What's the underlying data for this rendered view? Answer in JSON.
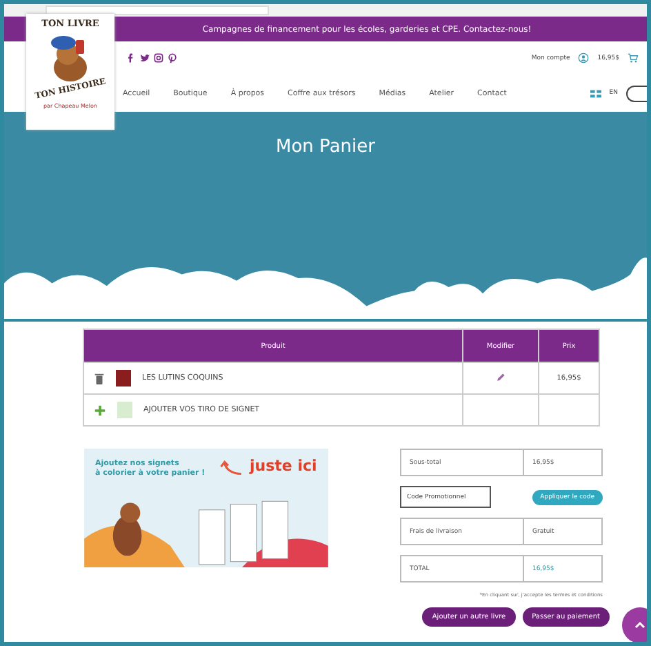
{
  "announcement": "Campagnes de financement pour les écoles, garderies et CPE. Contactez-nous!",
  "logo": {
    "top": "TON LIVRE",
    "bottom": "TON HISTOIRE",
    "byline": "par Chapeau Melon"
  },
  "account": {
    "label": "Mon compte",
    "cart_total": "16,95$"
  },
  "nav": [
    {
      "label": "Accueil"
    },
    {
      "label": "Boutique"
    },
    {
      "label": "À propos"
    },
    {
      "label": "Coffre aux trésors"
    },
    {
      "label": "Médias"
    },
    {
      "label": "Atelier"
    },
    {
      "label": "Contact"
    }
  ],
  "language": "EN",
  "hero": {
    "title": "Mon Panier"
  },
  "cart": {
    "columns": [
      "Produit",
      "Modifier",
      "Prix"
    ],
    "rows": [
      {
        "kind": "product",
        "name": "LES LUTINS COQUINS",
        "price": "16,95$"
      },
      {
        "kind": "addon",
        "name": "AJOUTER VOS TIRO DE SIGNET"
      }
    ]
  },
  "promo": {
    "line1": "Ajoutez nos signets",
    "line2": "à colorier à votre panier !",
    "callout": "juste ici"
  },
  "summary": {
    "subtotal_label": "Sous-total",
    "subtotal": "16,95$",
    "promo_placeholder": "Code Promotionnel",
    "apply": "Appliquer le code",
    "shipping_label": "Frais de livraison",
    "shipping": "Gratuit",
    "total_label": "TOTAL",
    "total": "16,95$",
    "terms": "*En cliquant sur, j'accepte les termes et conditions"
  },
  "buttons": [
    "Ajouter un autre livre",
    "Passer au paiement"
  ]
}
